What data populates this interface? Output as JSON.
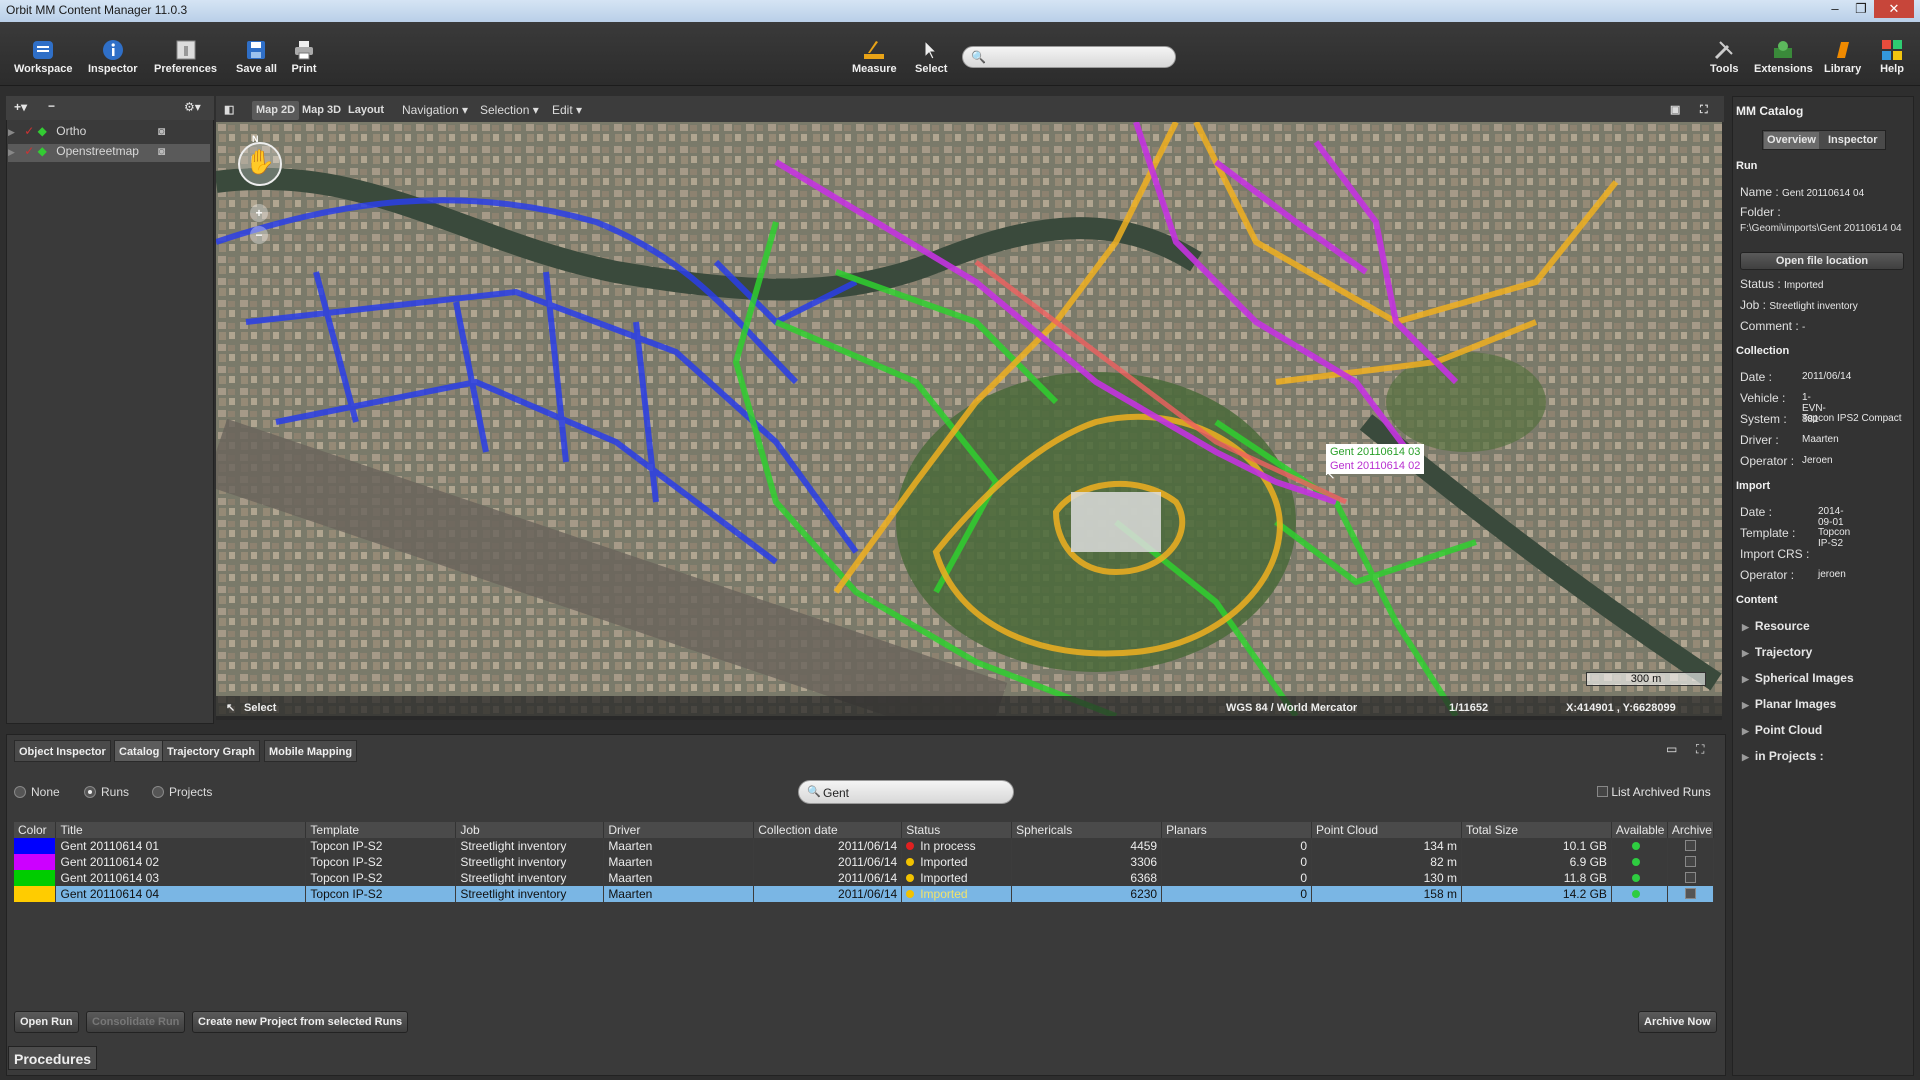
{
  "window": {
    "title": "Orbit MM Content Manager 11.0.3"
  },
  "toolbar": {
    "workspace": "Workspace",
    "inspector": "Inspector",
    "preferences": "Preferences",
    "save_all": "Save all",
    "print": "Print",
    "measure": "Measure",
    "select": "Select",
    "tools": "Tools",
    "extensions": "Extensions",
    "library": "Library",
    "help": "Help",
    "search_value": ""
  },
  "layers": {
    "items": [
      {
        "label": "Ortho"
      },
      {
        "label": "Openstreetmap"
      }
    ]
  },
  "map_toolbar": {
    "map2d": "Map 2D",
    "map3d": "Map 3D",
    "layout": "Layout",
    "navigation": "Navigation",
    "selection": "Selection",
    "edit": "Edit"
  },
  "map": {
    "labels": [
      "Gent 20110614 03",
      "Gent 20110614 02"
    ],
    "scale_bar": "300 m",
    "status_tool": "Select",
    "crs": "WGS 84 / World Mercator",
    "scale": "1/11652",
    "coords": "X:414901 , Y:6628099"
  },
  "catalog": {
    "header": "MM Catalog",
    "tabs": [
      "Overview",
      "Inspector"
    ],
    "run_section": "Run",
    "name_label": "Name :",
    "name": "Gent 20110614 04",
    "folder_label": "Folder :",
    "folder": "F:\\Geomi\\imports\\Gent 20110614 04",
    "open_file_location": "Open file location",
    "status_label": "Status :",
    "status": "Imported",
    "job_label": "Job :",
    "job": "Streetlight inventory",
    "comment_label": "Comment :",
    "comment": "-",
    "collection_section": "Collection",
    "date_label": "Date :",
    "date": "2011/06/14",
    "vehicle_label": "Vehicle :",
    "vehicle": "1-EVN-881",
    "system_label": "System :",
    "system": "Topcon IPS2 Compact",
    "driver_label": "Driver :",
    "driver": "Maarten",
    "operator_label": "Operator :",
    "operator": "Jeroen",
    "import_section": "Import",
    "import_date": "2014-09-01",
    "template_label": "Template :",
    "template": "Topcon IP-S2",
    "import_crs_label": "Import CRS :",
    "import_operator": "jeroen",
    "content_section": "Content",
    "content_items": [
      "Resource",
      "Trajectory",
      "Spherical Images",
      "Planar Images",
      "Point Cloud",
      "in Projects :"
    ]
  },
  "bottom": {
    "tabs": [
      "Object Inspector",
      "Catalog",
      "Trajectory Graph",
      "Mobile Mapping"
    ],
    "filter": {
      "none": "None",
      "runs": "Runs",
      "projects": "Projects",
      "selected": "Runs"
    },
    "search_value": "Gent",
    "list_archived": "List Archived Runs",
    "columns": [
      "Color",
      "Title",
      "Template",
      "Job",
      "Driver",
      "Collection date",
      "Status",
      "Sphericals",
      "Planars",
      "Point Cloud",
      "Total Size",
      "Available",
      "Archive"
    ],
    "rows": [
      {
        "color": "#0000ff",
        "title": "Gent 20110614 01",
        "template": "Topcon IP-S2",
        "job": "Streetlight inventory",
        "driver": "Maarten",
        "date": "2011/06/14",
        "status": "In process",
        "status_color": "#e02020",
        "sphericals": "4459",
        "planars": "0",
        "point_cloud": "134 m",
        "total": "10.1 GB",
        "archived": false
      },
      {
        "color": "#cc00ff",
        "title": "Gent 20110614 02",
        "template": "Topcon IP-S2",
        "job": "Streetlight inventory",
        "driver": "Maarten",
        "date": "2011/06/14",
        "status": "Imported",
        "status_color": "#f2c200",
        "sphericals": "3306",
        "planars": "0",
        "point_cloud": "82 m",
        "total": "6.9 GB",
        "archived": false
      },
      {
        "color": "#00cc00",
        "title": "Gent 20110614 03",
        "template": "Topcon IP-S2",
        "job": "Streetlight inventory",
        "driver": "Maarten",
        "date": "2011/06/14",
        "status": "Imported",
        "status_color": "#f2c200",
        "sphericals": "6368",
        "planars": "0",
        "point_cloud": "130 m",
        "total": "11.8 GB",
        "archived": false
      },
      {
        "color": "#ffcc00",
        "title": "Gent 20110614 04",
        "template": "Topcon IP-S2",
        "job": "Streetlight inventory",
        "driver": "Maarten",
        "date": "2011/06/14",
        "status": "Imported",
        "status_color": "#f2c200",
        "sphericals": "6230",
        "planars": "0",
        "point_cloud": "158 m",
        "total": "14.2 GB",
        "archived": true,
        "selected": true
      }
    ],
    "buttons": {
      "open_run": "Open Run",
      "consolidate_run": "Consolidate Run",
      "create_project": "Create new Project from selected Runs",
      "archive_now": "Archive Now"
    },
    "procedures": "Procedures"
  },
  "colors": {
    "accent": "#7ab6e4",
    "available": "#2ecc40"
  }
}
